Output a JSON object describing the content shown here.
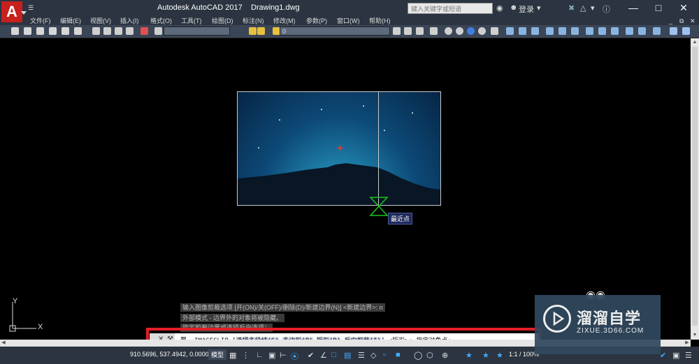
{
  "title_bar": {
    "app_name": "Autodesk AutoCAD 2017",
    "document": "Drawing1.dwg",
    "logo_letter": "A",
    "search_placeholder": "键入关键字或短语",
    "sign_in": "登录"
  },
  "menu": [
    "文件(F)",
    "编辑(E)",
    "视图(V)",
    "插入(I)",
    "格式(O)",
    "工具(T)",
    "绘图(D)",
    "标注(N)",
    "修改(M)",
    "参数(P)",
    "窗口(W)",
    "帮助(H)"
  ],
  "toolbar": {
    "layer_value": "0"
  },
  "snap": {
    "tooltip": "最近点"
  },
  "ucs": {
    "x_label": "X",
    "y_label": "Y"
  },
  "command_history": [
    "输入图像剪裁选项 [开(ON)/关(OFF)/删除(D)/新建边界(N)] <新建边界>: n",
    "外部模式 - 边界外的对象将被隐藏。",
    "指定剪裁边界或选择反向选项："
  ],
  "command_line": {
    "command": "IMAGECLIP",
    "bracket_open": "[",
    "options": [
      "选择多段线(S)",
      "多边形(P)",
      "矩形(R)",
      "反向剪裁(I)"
    ],
    "bracket_close": "]",
    "default": "<矩形>:",
    "prompt": "指定对角点:"
  },
  "status_bar": {
    "coordinates": "910.5696, 537.4942, 0.0000",
    "model_tab": "模型",
    "scale": "1:1 / 100%"
  },
  "watermark": {
    "name": "溜溜自学",
    "url": "ZIXUE.3D66.COM"
  },
  "colors": {
    "highlight": "#e31e25",
    "title_bar": "#2b3440",
    "logo": "#c8201c"
  }
}
